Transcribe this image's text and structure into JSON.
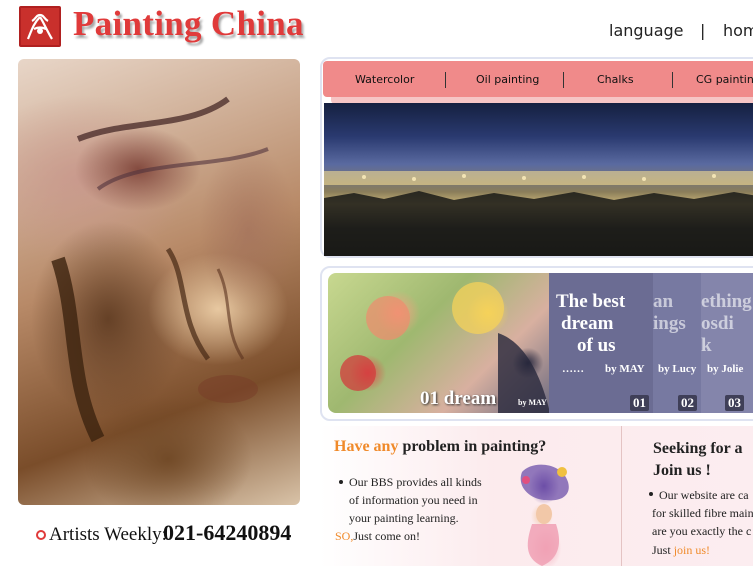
{
  "header": {
    "site_title": "Painting China",
    "nav_language": "language",
    "nav_separator": "|",
    "nav_home": "home"
  },
  "menu": {
    "items": [
      "Watercolor",
      "Oil painting",
      "Chalks",
      "CG painting"
    ]
  },
  "hotline": {
    "label": "Artists Weekly:",
    "number": "021-64240894"
  },
  "gallery": {
    "featured_caption": "01 dream",
    "featured_by": "by MAY",
    "slides": [
      {
        "title_lines": [
          "The best",
          "dream",
          "of us"
        ],
        "ellipsis": "……",
        "by": "by MAY",
        "number": "01"
      },
      {
        "title_lines": [
          "an",
          "ings"
        ],
        "by": "by Lucy",
        "number": "02"
      },
      {
        "title_lines": [
          "ething",
          "osdi",
          "k"
        ],
        "by": "by Jolie",
        "number": "03"
      }
    ]
  },
  "bbs": {
    "heading_highlight": "Have any",
    "heading_rest": " problem in painting?",
    "lines": [
      "Our BBS provides all kinds",
      "of information you need in",
      "your painting learning."
    ],
    "cta_highlight": "SO,",
    "cta_rest": "Just come on!"
  },
  "join": {
    "heading_line1": "Seeking for a",
    "heading_line2": "Join us !",
    "lines": [
      "Our website are ca",
      "for skilled fibre main",
      "are you exactly the c"
    ],
    "cta_prefix": "Just ",
    "cta_highlight": "join us!"
  },
  "colors": {
    "brand_red": "#e03a3a",
    "menu_pink": "#f08a8a",
    "highlight_orange": "#f08a2a",
    "slide_purple": "#6b6c93"
  }
}
